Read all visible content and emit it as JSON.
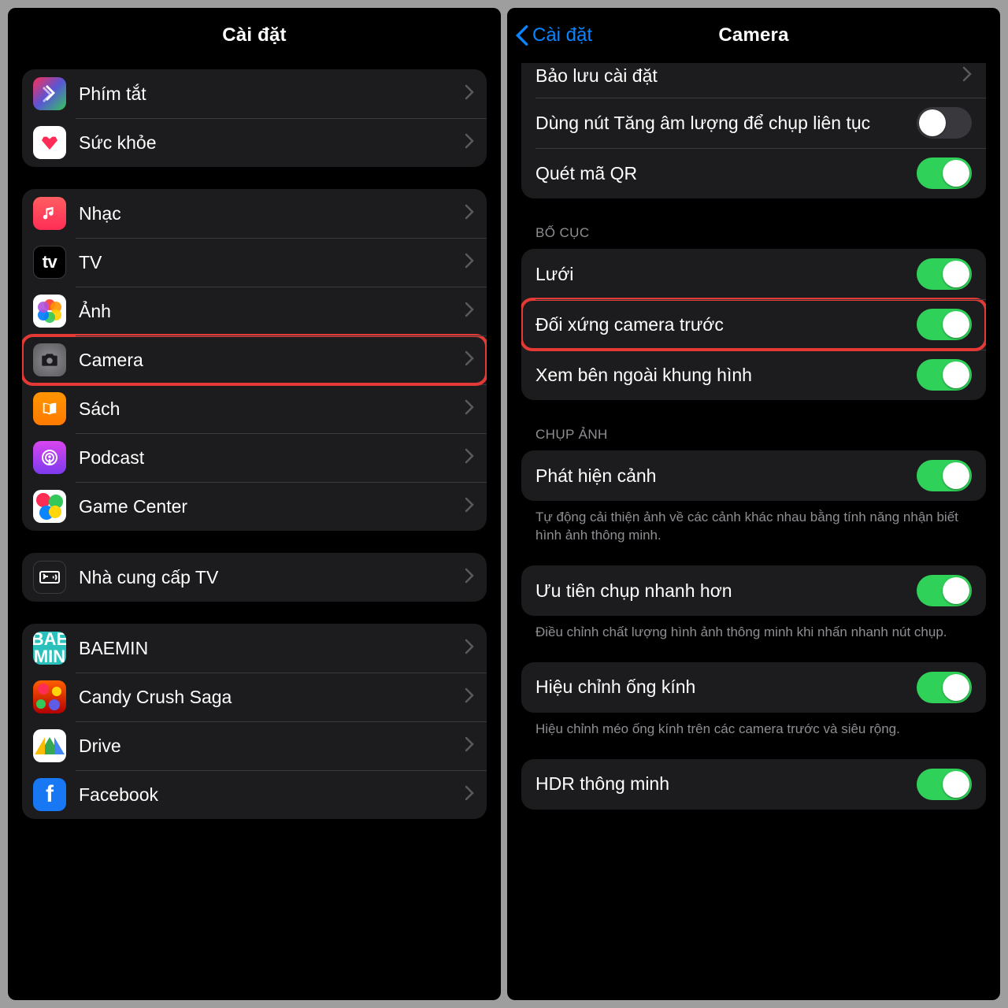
{
  "left": {
    "title": "Cài đặt",
    "groups": [
      {
        "rows": [
          {
            "id": "shortcuts",
            "label": "Phím tắt"
          },
          {
            "id": "health",
            "label": "Sức khỏe"
          }
        ]
      },
      {
        "rows": [
          {
            "id": "music",
            "label": "Nhạc"
          },
          {
            "id": "tv",
            "label": "TV"
          },
          {
            "id": "photos",
            "label": "Ảnh"
          },
          {
            "id": "camera",
            "label": "Camera",
            "highlight": true
          },
          {
            "id": "books",
            "label": "Sách"
          },
          {
            "id": "podcast",
            "label": "Podcast"
          },
          {
            "id": "gamectr",
            "label": "Game Center"
          }
        ]
      },
      {
        "rows": [
          {
            "id": "tvprov",
            "label": "Nhà cung cấp TV"
          }
        ]
      },
      {
        "rows": [
          {
            "id": "baemin",
            "label": "BAEMIN"
          },
          {
            "id": "candy",
            "label": "Candy Crush Saga"
          },
          {
            "id": "drive",
            "label": "Drive"
          },
          {
            "id": "fb",
            "label": "Facebook"
          }
        ]
      }
    ]
  },
  "right": {
    "back": "Cài đặt",
    "title": "Camera",
    "top_rows": [
      {
        "id": "preserve",
        "label": "Bảo lưu cài đặt",
        "type": "chev"
      },
      {
        "id": "volburst",
        "label": "Dùng nút Tăng âm lượng để chụp liên tục",
        "type": "switch",
        "on": false
      },
      {
        "id": "qr",
        "label": "Quét mã QR",
        "type": "switch",
        "on": true
      }
    ],
    "sections": [
      {
        "title": "BỐ CỤC",
        "rows": [
          {
            "id": "grid",
            "label": "Lưới",
            "type": "switch",
            "on": true
          },
          {
            "id": "mirror",
            "label": "Đối xứng camera trước",
            "type": "switch",
            "on": true,
            "highlight": true
          },
          {
            "id": "outside",
            "label": "Xem bên ngoài khung hình",
            "type": "switch",
            "on": true
          }
        ]
      },
      {
        "title": "CHỤP ẢNH",
        "rows": [
          {
            "id": "scene",
            "label": "Phát hiện cảnh",
            "type": "switch",
            "on": true
          }
        ],
        "note": "Tự động cải thiện ảnh về các cảnh khác nhau bằng tính năng nhận biết hình ảnh thông minh."
      },
      {
        "rows": [
          {
            "id": "faster",
            "label": "Ưu tiên chụp nhanh hơn",
            "type": "switch",
            "on": true
          }
        ],
        "note": "Điều chỉnh chất lượng hình ảnh thông minh khi nhấn nhanh nút chụp."
      },
      {
        "rows": [
          {
            "id": "lenscorr",
            "label": "Hiệu chỉnh ống kính",
            "type": "switch",
            "on": true
          }
        ],
        "note": "Hiệu chỉnh méo ống kính trên các camera trước và siêu rộng."
      },
      {
        "rows": [
          {
            "id": "hdr",
            "label": "HDR thông minh",
            "type": "switch",
            "on": true
          }
        ]
      }
    ]
  }
}
